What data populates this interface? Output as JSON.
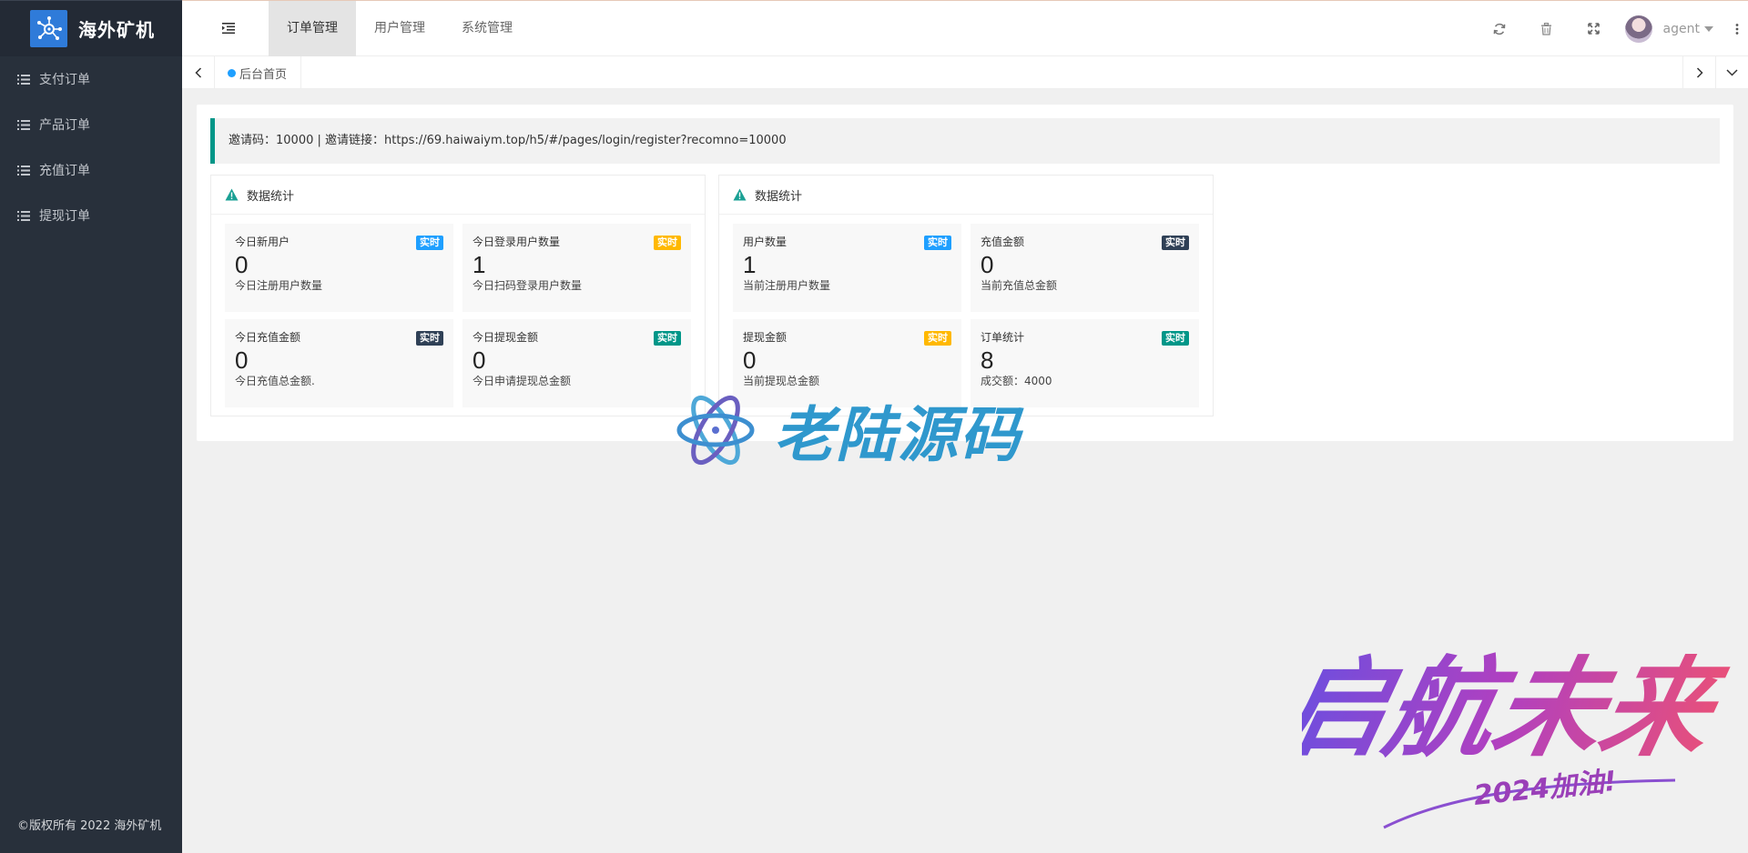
{
  "app": {
    "name": "海外矿机"
  },
  "sidebar": {
    "items": [
      {
        "label": "支付订单"
      },
      {
        "label": "产品订单"
      },
      {
        "label": "充值订单"
      },
      {
        "label": "提现订单"
      }
    ],
    "copyright": "©版权所有 2022 海外矿机"
  },
  "header": {
    "nav": [
      {
        "label": "订单管理",
        "active": true
      },
      {
        "label": "用户管理",
        "active": false
      },
      {
        "label": "系统管理",
        "active": false
      }
    ],
    "tools": [
      "refresh-icon",
      "trash-icon",
      "fullscreen-icon"
    ],
    "username": "agent"
  },
  "tabs": [
    {
      "label": "后台首页"
    }
  ],
  "invite": {
    "text": "邀请码：10000 | 邀请链接：https://69.haiwaiym.top/h5/#/pages/login/register?recomno=10000"
  },
  "panels": [
    {
      "title": "数据统计",
      "cards": [
        {
          "title": "今日新用户",
          "badge": "实时",
          "badge_color": "#1e9fff",
          "value": "0",
          "desc": "今日注册用户数量"
        },
        {
          "title": "今日登录用户数量",
          "badge": "实时",
          "badge_color": "#ffb800",
          "value": "1",
          "desc": "今日扫码登录用户数量"
        },
        {
          "title": "今日充值金额",
          "badge": "实时",
          "badge_color": "#2f4056",
          "value": "0",
          "desc": "今日充值总金额."
        },
        {
          "title": "今日提现金额",
          "badge": "实时",
          "badge_color": "#009688",
          "value": "0",
          "desc": "今日申请提现总金额"
        }
      ]
    },
    {
      "title": "数据统计",
      "cards": [
        {
          "title": "用户数量",
          "badge": "实时",
          "badge_color": "#1e9fff",
          "value": "1",
          "desc": "当前注册用户数量"
        },
        {
          "title": "充值金额",
          "badge": "实时",
          "badge_color": "#2f4056",
          "value": "0",
          "desc": "当前充值总金额"
        },
        {
          "title": "提现金额",
          "badge": "实时",
          "badge_color": "#ffb800",
          "value": "0",
          "desc": "当前提现总金额"
        },
        {
          "title": "订单统计",
          "badge": "实时",
          "badge_color": "#009688",
          "value": "8",
          "desc": "成交额：4000"
        }
      ]
    }
  ],
  "watermarks": {
    "center": "老陆源码",
    "corner": "启航未来",
    "corner_sub": "2024加油!"
  }
}
